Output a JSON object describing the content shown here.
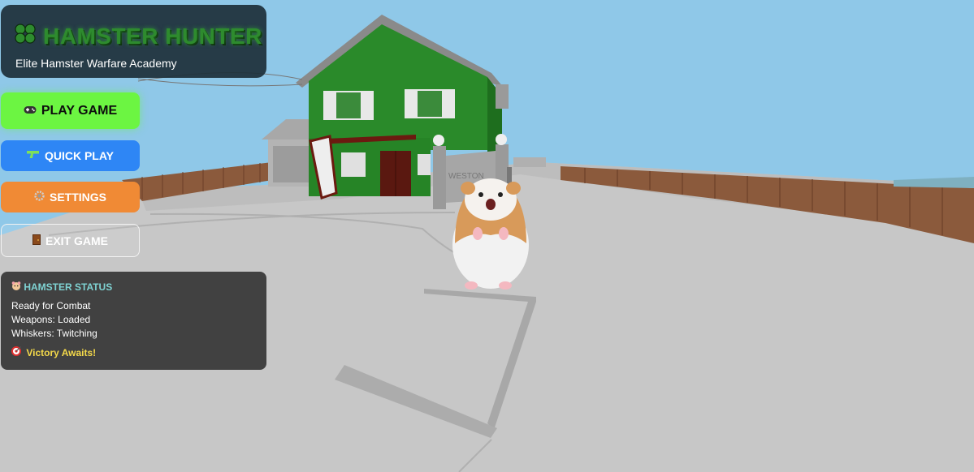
{
  "title_panel": {
    "title": "HAMSTER HUNTER",
    "subtitle": "Elite Hamster Warfare Academy",
    "icon": "paw-icon"
  },
  "menu": {
    "play": {
      "label": "PLAY GAME",
      "icon": "gamepad-icon",
      "color": "#6cf542"
    },
    "quick": {
      "label": "QUICK PLAY",
      "icon": "gun-icon",
      "color": "#2e86f5"
    },
    "settings": {
      "label": "SETTINGS",
      "icon": "gear-icon",
      "color": "#f08a35"
    },
    "exit": {
      "label": "EXIT GAME",
      "icon": "door-icon"
    }
  },
  "status": {
    "heading": "HAMSTER STATUS",
    "icon": "hamster-icon",
    "lines": [
      "Ready for Combat",
      "Weapons: Loaded",
      "Whiskers: Twitching"
    ],
    "victory": "Victory Awaits!",
    "victory_icon": "target-icon"
  },
  "scene": {
    "sky_color": "#8fc8e8",
    "ground_color": "#c8c8c8",
    "house_color": "#2a8a2a",
    "gate_sign": "WESTON"
  }
}
